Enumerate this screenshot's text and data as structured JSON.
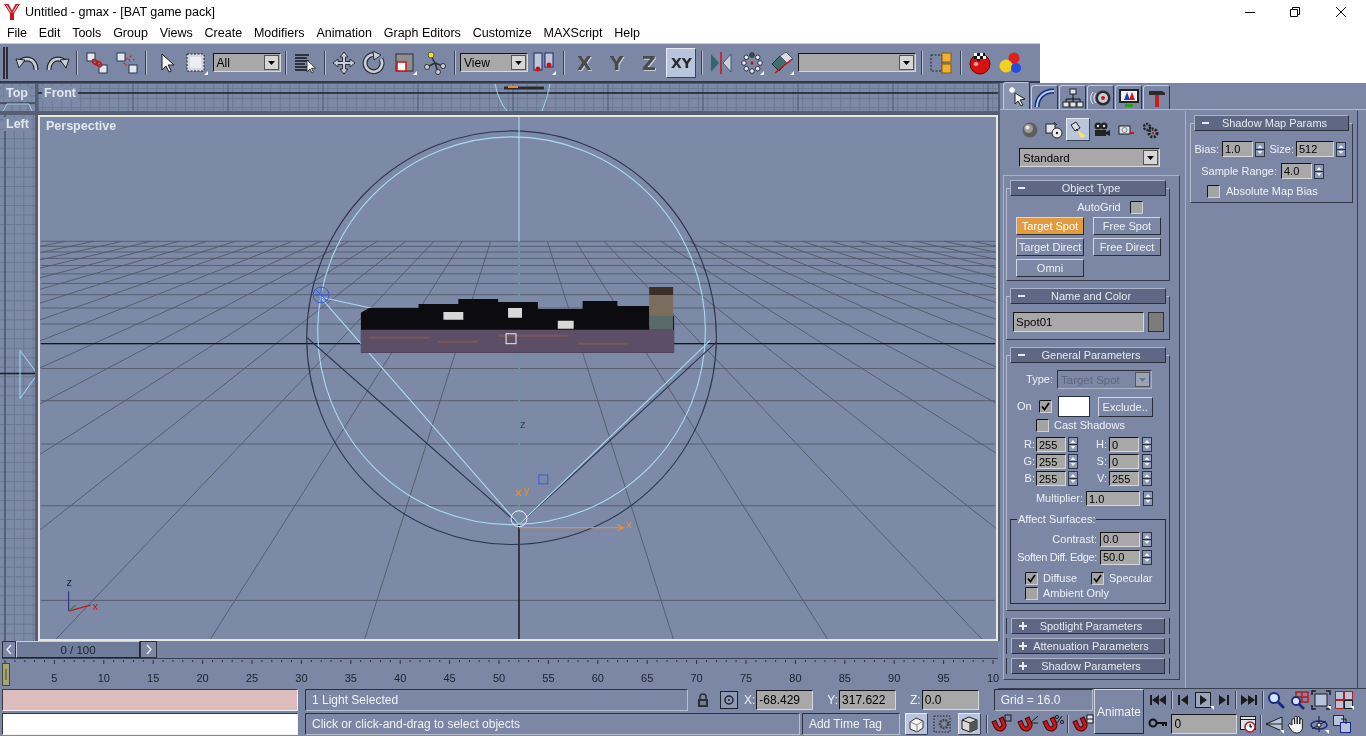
{
  "window": {
    "title": "Untitled - gmax - [BAT game pack]"
  },
  "menu_bar": [
    "File",
    "Edit",
    "Tools",
    "Group",
    "Views",
    "Create",
    "Modifiers",
    "Animation",
    "Graph Editors",
    "Customize",
    "MAXScript",
    "Help"
  ],
  "main_toolbar": {
    "selection_filter": "All",
    "reference_coordinate_system": "View",
    "axis_constraints": [
      {
        "label": "X",
        "selected": false
      },
      {
        "label": "Y",
        "selected": false
      },
      {
        "label": "Z",
        "selected": false
      },
      {
        "label": "XY",
        "selected": true
      }
    ]
  },
  "viewports": [
    {
      "label": "Top",
      "active": false
    },
    {
      "label": "Front",
      "active": false
    },
    {
      "label": "Left",
      "active": false
    },
    {
      "label": "Perspective",
      "active": true
    }
  ],
  "perspective_scene": {
    "gizmo_axes": [
      "z",
      "y",
      "x"
    ],
    "tripod_axes": [
      "z",
      "x"
    ]
  },
  "time_slider": {
    "label": "0 / 100",
    "level": 0
  },
  "track_bar": {
    "ticks": [
      "5",
      "10",
      "15",
      "20",
      "25",
      "30",
      "35",
      "40",
      "45",
      "50",
      "55",
      "60",
      "65",
      "70",
      "75",
      "80",
      "85",
      "90",
      "95",
      "10"
    ]
  },
  "command_panel": {
    "tabs": [
      {
        "selected": true
      },
      {
        "selected": false
      },
      {
        "selected": false
      },
      {
        "selected": false
      },
      {
        "selected": false
      },
      {
        "selected": false
      }
    ],
    "categories": [
      {
        "selected": false
      },
      {
        "selected": false
      },
      {
        "selected": true
      },
      {
        "selected": false
      },
      {
        "selected": false
      },
      {
        "selected": false
      }
    ],
    "subcategory": "Standard",
    "object_type": {
      "title": "Object Type",
      "expanded": true,
      "autogrid": {
        "label": "AutoGrid",
        "checked": false
      },
      "buttons": [
        {
          "label": "Target Spot",
          "selected": true
        },
        {
          "label": "Free Spot",
          "selected": false
        },
        {
          "label": "Target Direct",
          "selected": false
        },
        {
          "label": "Free Direct",
          "selected": false
        },
        {
          "label": "Omni",
          "selected": false
        }
      ]
    },
    "name_and_color": {
      "title": "Name and Color",
      "expanded": true,
      "name": "Spot01",
      "color": "#7c7c7c"
    },
    "general_parameters": {
      "title": "General Parameters",
      "expanded": true,
      "type": {
        "label": "Type:",
        "value": "Target Spot",
        "disabled": true
      },
      "on": {
        "label": "On",
        "checked": true
      },
      "color": "#ffffff",
      "exclude_button": "Exclude..",
      "cast_shadows": {
        "label": "Cast Shadows",
        "checked": false
      },
      "color_spinners": [
        {
          "label": "R:",
          "value": "255"
        },
        {
          "label": "H:",
          "value": "0"
        },
        {
          "label": "G:",
          "value": "255"
        },
        {
          "label": "S:",
          "value": "0"
        },
        {
          "label": "B:",
          "value": "255"
        },
        {
          "label": "V:",
          "value": "255"
        }
      ],
      "multiplier": {
        "label": "Multiplier:",
        "value": "1.0"
      },
      "affect_surfaces": {
        "title": "Affect Surfaces:",
        "contrast": {
          "label": "Contrast:",
          "value": "0.0"
        },
        "soften_diff_edge": {
          "label": "Soften Diff. Edge:",
          "value": "50.0"
        },
        "options": [
          {
            "label": "Diffuse",
            "checked": true
          },
          {
            "label": "Specular",
            "checked": true
          },
          {
            "label": "Ambient Only",
            "checked": false
          }
        ]
      }
    },
    "collapsed_rollouts": [
      {
        "title": "Spotlight Parameters",
        "expanded": false
      },
      {
        "title": "Attenuation Parameters",
        "expanded": false
      },
      {
        "title": "Shadow Parameters",
        "expanded": false
      }
    ],
    "shadow_map_params": {
      "title": "Shadow Map Params",
      "expanded": true,
      "bias": {
        "label": "Bias:",
        "value": "1.0"
      },
      "size": {
        "label": "Size:",
        "value": "512"
      },
      "sample_range": {
        "label": "Sample Range:",
        "value": "4.0"
      },
      "absolute_map_bias": {
        "label": "Absolute Map Bias",
        "checked": false
      }
    }
  },
  "status_bar": {
    "selection_status": "1 Light Selected",
    "prompt": "Click or click-and-drag to select objects",
    "coordinates": [
      {
        "label": "X:",
        "value": "-68.429"
      },
      {
        "label": "Y:",
        "value": "317.622"
      },
      {
        "label": "Z:",
        "value": "0.0"
      }
    ],
    "grid": "Grid = 16.0",
    "add_time_tag": "Add Time Tag",
    "viewport_toggles": [
      {
        "selected": true
      },
      {
        "selected": false
      },
      {
        "selected": true
      }
    ],
    "animate": {
      "label": "Animate",
      "on": false
    },
    "current_frame": "0"
  }
}
